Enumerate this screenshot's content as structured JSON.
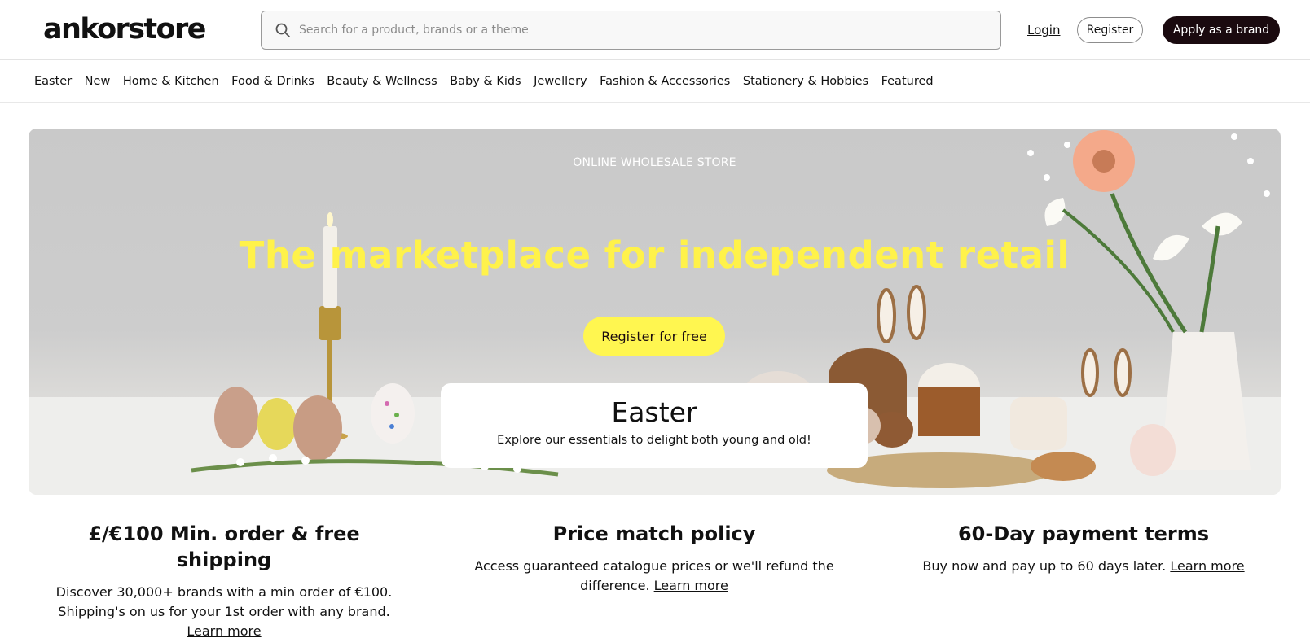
{
  "header": {
    "logo": "ankorstore",
    "search_placeholder": "Search for a product, brands or a theme",
    "login_label": "Login",
    "register_label": "Register",
    "apply_label": "Apply as a brand"
  },
  "categories": [
    "Easter",
    "New",
    "Home & Kitchen",
    "Food & Drinks",
    "Beauty & Wellness",
    "Baby & Kids",
    "Jewellery",
    "Fashion & Accessories",
    "Stationery & Hobbies",
    "Featured"
  ],
  "hero": {
    "tag": "ONLINE WHOLESALE STORE",
    "title": "The marketplace for independent retail",
    "cta_label": "Register for free",
    "card_title": "Easter",
    "card_subtitle": "Explore our essentials to delight both young and old!"
  },
  "features": [
    {
      "title": "£/€100 Min. order & free shipping",
      "text": "Discover 30,000+ brands with a min order of €100. Shipping's on us for your 1st order with any brand.",
      "link": "Learn more"
    },
    {
      "title": "Price match policy",
      "text": "Access guaranteed catalogue prices or we'll refund the difference.",
      "link": "Learn more"
    },
    {
      "title": "60-Day payment terms",
      "text": "Buy now and pay up to 60 days later.",
      "link": "Learn more"
    }
  ],
  "colors": {
    "brand_dark": "#1a0a0f",
    "accent_yellow": "#fff650",
    "hero_title": "#fff24a"
  }
}
